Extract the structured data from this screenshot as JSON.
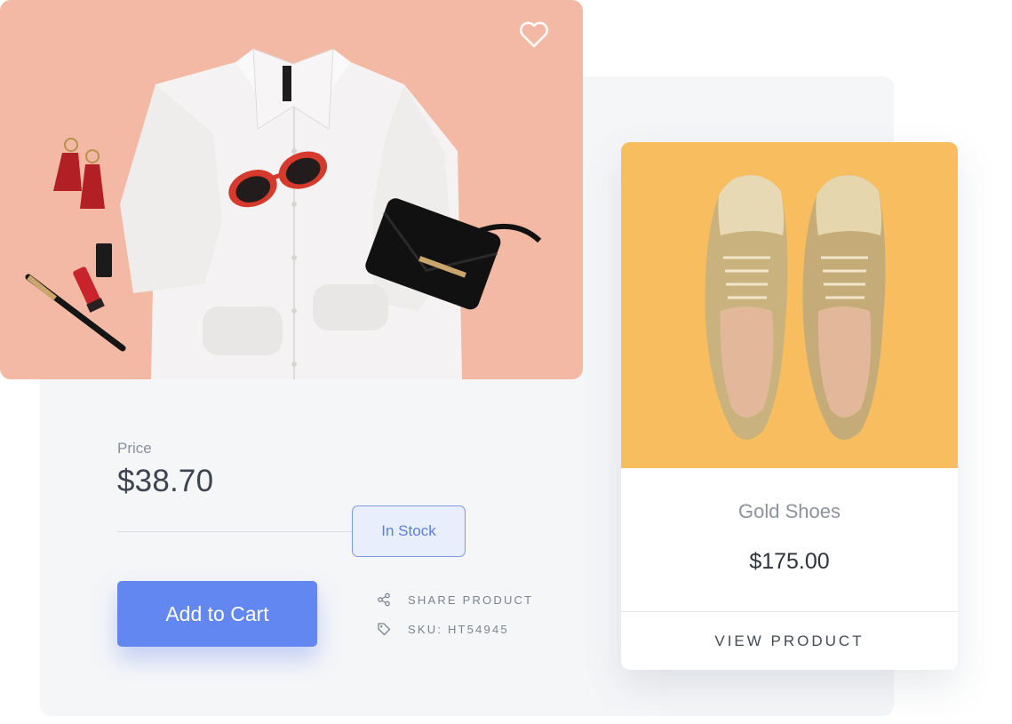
{
  "main_product": {
    "image_alt": "white shirt flat lay with accessories",
    "favorite_icon": "heart-outline-icon",
    "price_label": "Price",
    "price": "$38.70",
    "stock_status": "In Stock",
    "add_to_cart_label": "Add to Cart",
    "share_label": "SHARE PRODUCT",
    "share_icon": "share-icon",
    "sku_label": "SKU: HT54945",
    "sku_icon": "tag-icon"
  },
  "related_product": {
    "image_alt": "gold metallic shoes",
    "name": "Gold Shoes",
    "price": "$175.00",
    "view_label": "VIEW PRODUCT"
  },
  "colors": {
    "accent": "#6387f0",
    "hero_background": "#f3b9a4",
    "card_image_background": "#f8bd5e",
    "stock_badge": "#5c7de6"
  }
}
